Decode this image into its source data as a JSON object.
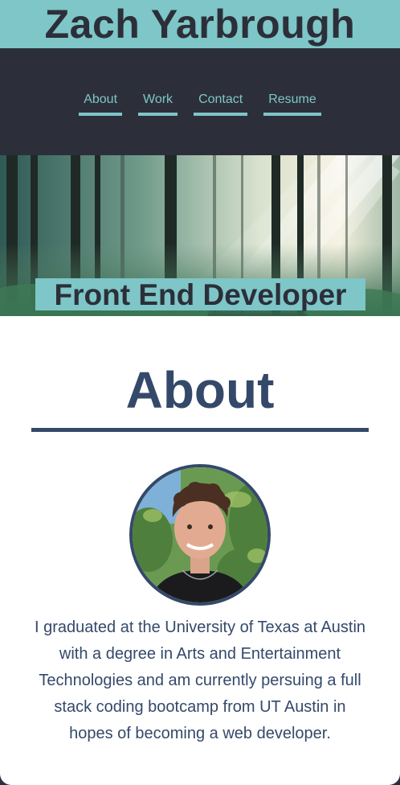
{
  "header": {
    "site_title": "Zach Yarbrough"
  },
  "nav": {
    "items": [
      {
        "label": "About"
      },
      {
        "label": "Work"
      },
      {
        "label": "Contact"
      },
      {
        "label": "Resume"
      }
    ]
  },
  "hero": {
    "tagline": "Front End Developer",
    "image": "forest-sunbeams"
  },
  "about": {
    "heading": "About",
    "photo": "profile-photo",
    "bio": "I graduated at the University of Texas at Austin with a degree in Arts and Entertainment Technologies and am currently persuing a full stack coding bootcamp from UT Austin in hopes of becoming a web developer."
  },
  "colors": {
    "accent": "#7ec6c7",
    "dark": "#2c2f3a",
    "heading": "#34496a",
    "content_bg": "#ffffff"
  }
}
